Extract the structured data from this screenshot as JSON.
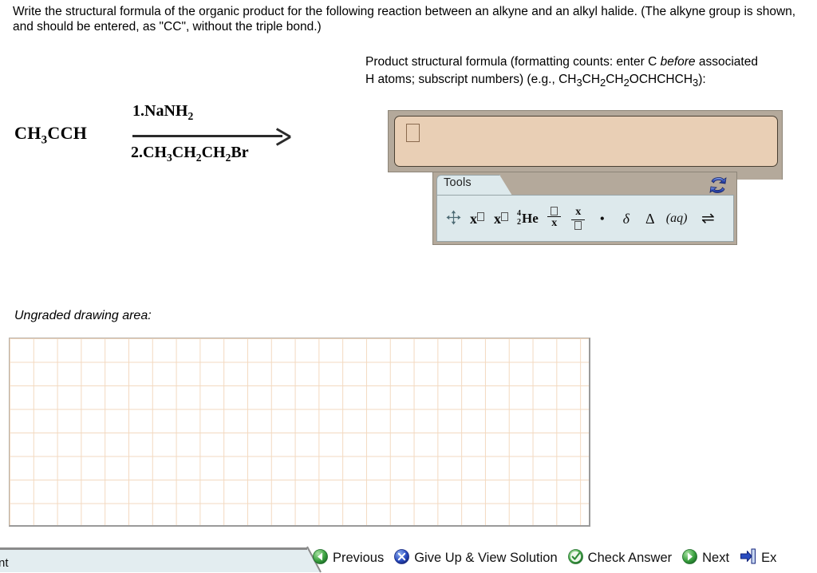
{
  "question": {
    "prompt_line1": "Write the structural formula of the organic product for the following reaction between an alkyne and an alkyl",
    "prompt_line2": "halide. (The alkyne group is shown, and should be entered, as \"CC\", without the triple bond.)"
  },
  "reaction": {
    "reactant": "CH3CCH",
    "reactant_parts": {
      "c": "CH",
      "sub3": "3",
      "rest": "CCH"
    },
    "above_arrow": "1.NaNH2",
    "above_parts": {
      "pre": "1.NaNH",
      "sub": "2"
    },
    "below_arrow": "2.CH3CH2CH2Br",
    "below_parts": {
      "p1": "2.CH",
      "s1": "3",
      "p2": "CH",
      "s2": "2",
      "p3": "CH",
      "s3": "2",
      "p4": "Br"
    },
    "arrow_symbol": "right-arrow"
  },
  "product": {
    "instruction_line1": "Product structural formula (formatting counts: enter C",
    "instruction_italic": "before",
    "instruction_line2_rest": " associated H atoms; subscript numbers) (e.g.,",
    "example_parts": {
      "p1": "CH",
      "s1": "3",
      "p2": "CH",
      "s2": "2",
      "p3": "CH",
      "s3": "2",
      "p4": "OCHCHCH",
      "s4": "3",
      "p5": "):"
    },
    "example_plain": "CH3CH2CH2OCHCHCH3):",
    "answer_value": "",
    "answer_placeholder": ""
  },
  "tools": {
    "tab_label": "Tools",
    "reset_icon": "refresh-arrows-icon",
    "items": [
      {
        "name": "move-tool",
        "glyph": "move-cross-arrows"
      },
      {
        "name": "superscript-tool",
        "glyph": "x-superscript-box"
      },
      {
        "name": "subscript-tool",
        "glyph": "x-subscript-box"
      },
      {
        "name": "isotope-tool",
        "glyph": "He",
        "mass_number": "4",
        "atomic_number": "2"
      },
      {
        "name": "fraction-numerator-tool",
        "glyph": "box-over-x",
        "num": "box",
        "den": "x"
      },
      {
        "name": "fraction-denominator-tool",
        "glyph": "x-over-box",
        "num": "x",
        "den": "box"
      },
      {
        "name": "bullet-tool",
        "glyph": "•"
      },
      {
        "name": "delta-lowercase-tool",
        "glyph": "δ"
      },
      {
        "name": "delta-uppercase-tool",
        "glyph": "Δ"
      },
      {
        "name": "aqueous-tool",
        "glyph": "(aq)"
      },
      {
        "name": "equilibrium-arrow-tool",
        "glyph": "⇌"
      }
    ]
  },
  "drawing_area": {
    "label": "Ungraded drawing area:"
  },
  "bottom": {
    "assignment_tab_label": "nt",
    "nav": [
      {
        "name": "previous-button",
        "label": "Previous",
        "icon": "green-left-arrow-icon",
        "color": "#2f9b3e"
      },
      {
        "name": "give-up-button",
        "label": "Give Up & View Solution",
        "icon": "blue-x-circle-icon",
        "color": "#2347bd"
      },
      {
        "name": "check-answer-button",
        "label": "Check Answer",
        "icon": "green-check-circle-icon",
        "color": "#2f9b3e"
      },
      {
        "name": "next-button",
        "label": "Next",
        "icon": "green-right-arrow-icon",
        "color": "#2f9b3e"
      },
      {
        "name": "exit-button",
        "label": "Ex",
        "icon": "blue-exit-door-icon",
        "color": "#2347bd"
      }
    ]
  },
  "colors": {
    "answer_field_bg": "#e9cfb5",
    "frame_bg": "#b4a99b",
    "tools_bg": "#dde9ec",
    "grid_line": "#f3d9c0",
    "bottom_tab_bg": "#e3edf0"
  }
}
